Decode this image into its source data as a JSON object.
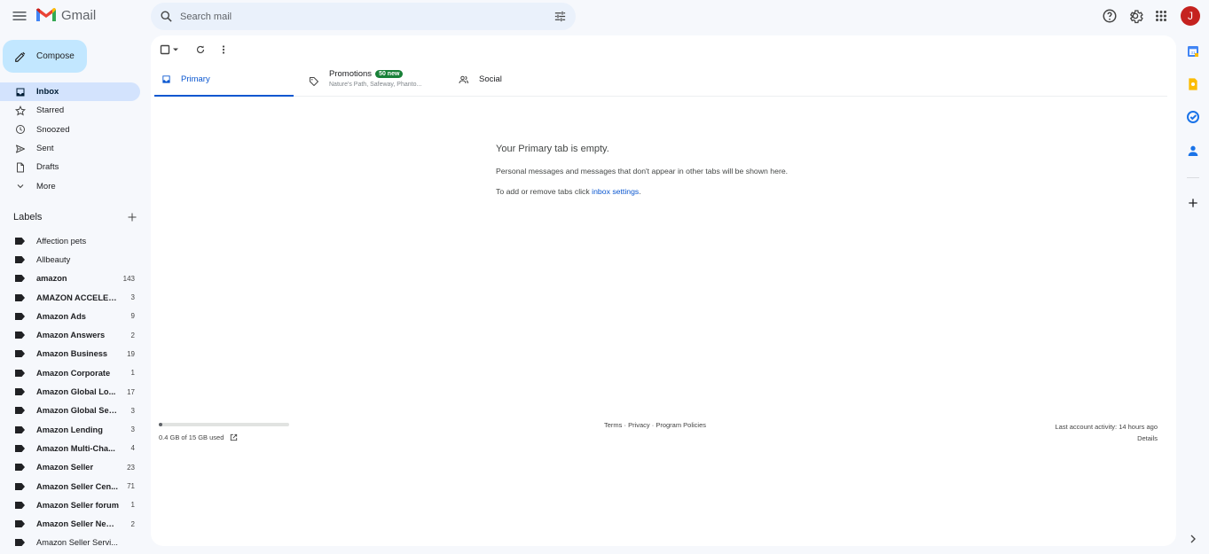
{
  "header": {
    "app_name": "Gmail",
    "search_placeholder": "Search mail",
    "avatar_initial": "J"
  },
  "compose": {
    "label": "Compose"
  },
  "nav": [
    {
      "label": "Inbox",
      "icon": "inbox-icon",
      "active": true
    },
    {
      "label": "Starred",
      "icon": "star-icon"
    },
    {
      "label": "Snoozed",
      "icon": "clock-icon"
    },
    {
      "label": "Sent",
      "icon": "send-icon"
    },
    {
      "label": "Drafts",
      "icon": "draft-icon"
    },
    {
      "label": "More",
      "icon": "chevron-down-icon"
    }
  ],
  "labels": {
    "title": "Labels",
    "items": [
      {
        "name": "Affection pets",
        "count": "",
        "bold": false
      },
      {
        "name": "Allbeauty",
        "count": "",
        "bold": false
      },
      {
        "name": "amazon",
        "count": "143",
        "bold": true
      },
      {
        "name": "AMAZON ACCELER...",
        "count": "3",
        "bold": true
      },
      {
        "name": "Amazon Ads",
        "count": "9",
        "bold": true
      },
      {
        "name": "Amazon Answers",
        "count": "2",
        "bold": true
      },
      {
        "name": "Amazon Business",
        "count": "19",
        "bold": true
      },
      {
        "name": "Amazon Corporate",
        "count": "1",
        "bold": true
      },
      {
        "name": "Amazon Global Lo...",
        "count": "17",
        "bold": true
      },
      {
        "name": "Amazon Global Sell...",
        "count": "3",
        "bold": true
      },
      {
        "name": "Amazon Lending",
        "count": "3",
        "bold": true
      },
      {
        "name": "Amazon Multi-Cha...",
        "count": "4",
        "bold": true
      },
      {
        "name": "Amazon Seller",
        "count": "23",
        "bold": true
      },
      {
        "name": "Amazon Seller Cen...",
        "count": "71",
        "bold": true
      },
      {
        "name": "Amazon Seller forum",
        "count": "1",
        "bold": true
      },
      {
        "name": "Amazon Seller New...",
        "count": "2",
        "bold": true
      },
      {
        "name": "Amazon Seller Servi...",
        "count": "",
        "bold": false
      }
    ]
  },
  "tabs": {
    "primary": {
      "label": "Primary"
    },
    "promotions": {
      "label": "Promotions",
      "badge": "50 new",
      "subtitle": "Nature's Path, Safeway, Phanto..."
    },
    "social": {
      "label": "Social"
    }
  },
  "empty_state": {
    "title": "Your Primary tab is empty.",
    "line1": "Personal messages and messages that don't appear in other tabs will be shown here.",
    "line2_prefix": "To add or remove tabs click ",
    "line2_link": "inbox settings",
    "line2_suffix": "."
  },
  "footer": {
    "storage_text": "0.4 GB of 15 GB used",
    "storage_fraction": 0.027,
    "links": "Terms · Privacy · Program Policies",
    "activity": "Last account activity: 14 hours ago",
    "details": "Details"
  },
  "colors": {
    "accent": "#0b57d0",
    "compose_bg": "#c2e7ff",
    "active_nav_bg": "#d3e3fd",
    "badge_green": "#188038",
    "avatar_bg": "#c5221f"
  }
}
